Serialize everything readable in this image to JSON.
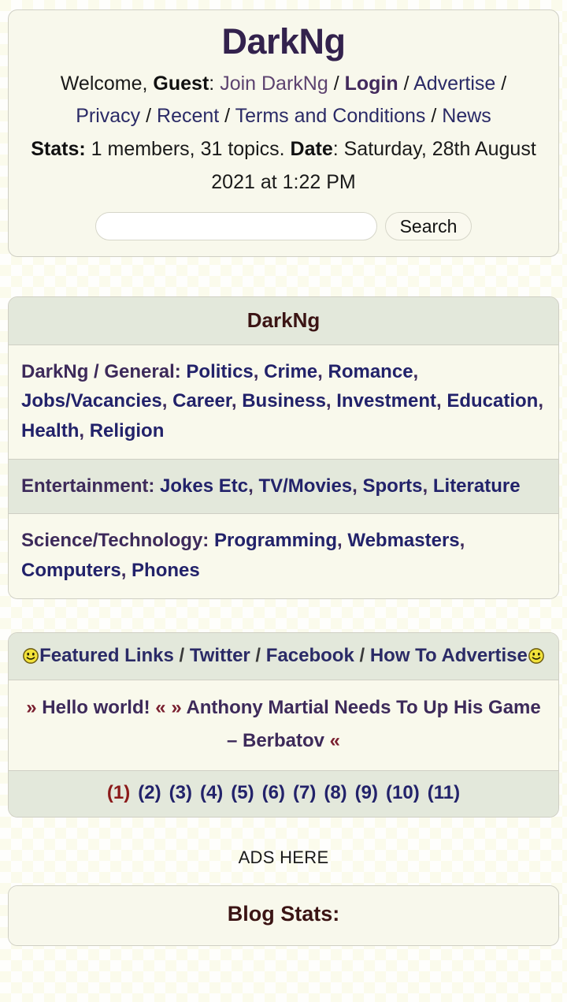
{
  "site": {
    "title": "DarkNg"
  },
  "header": {
    "welcome_prefix": "Welcome, ",
    "guest_label": "Guest",
    "colon": ": ",
    "join_label": "Join DarkNg",
    "login_label": "Login",
    "advertise_label": "Advertise",
    "privacy_label": "Privacy",
    "recent_label": "Recent",
    "terms_label": "Terms and Conditions",
    "news_label": "News",
    "stats_label": "Stats:",
    "stats_value": " 1 members, 31 topics. ",
    "date_label": "Date",
    "date_value": ": Saturday, 28th August 2021 at 1:22 PM",
    "separator": " / "
  },
  "search": {
    "value": "",
    "placeholder": "",
    "button_label": "Search"
  },
  "nav": {
    "panel_title": "DarkNg",
    "rows": [
      {
        "group": "DarkNg / General",
        "links": [
          "Politics",
          "Crime",
          "Romance",
          "Jobs/Vacancies",
          "Career",
          "Business",
          "Investment",
          "Education",
          "Health",
          "Religion"
        ]
      },
      {
        "group": "Entertainment",
        "links": [
          "Jokes Etc",
          "TV/Movies",
          "Sports",
          "Literature"
        ]
      },
      {
        "group": "Science/Technology",
        "links": [
          "Programming",
          "Webmasters",
          "Computers",
          "Phones"
        ]
      }
    ]
  },
  "featured": {
    "icon_name": "smiley-icon",
    "links": [
      "Featured Links",
      "Twitter",
      "Facebook",
      "How To Advertise"
    ],
    "posts": [
      "Hello world!",
      "Anthony Martial Needs To Up His Game – Berbatov"
    ],
    "chevron_open": "»",
    "chevron_close": "«",
    "pages": [
      "(1)",
      "(2)",
      "(3)",
      "(4)",
      "(5)",
      "(6)",
      "(7)",
      "(8)",
      "(9)",
      "(10)",
      "(11)"
    ],
    "active_page_index": 0
  },
  "ads": {
    "label": "ADS HERE"
  },
  "blog_stats": {
    "title": "Blog Stats:"
  },
  "colors": {
    "page_bg": "#fbfbec",
    "panel_bg": "#f8f8ec",
    "panel_head_bg": "#e3e8db",
    "panel_border": "#cfcfc4",
    "title_purple": "#33224d",
    "link_navy": "#2a2a66",
    "link_purple": "#5d4370",
    "heading_brown": "#3b1414",
    "active_page_red": "#8b1a1a",
    "chevron_maroon": "#7a2030",
    "smiley_yellow": "#f2e23a"
  }
}
